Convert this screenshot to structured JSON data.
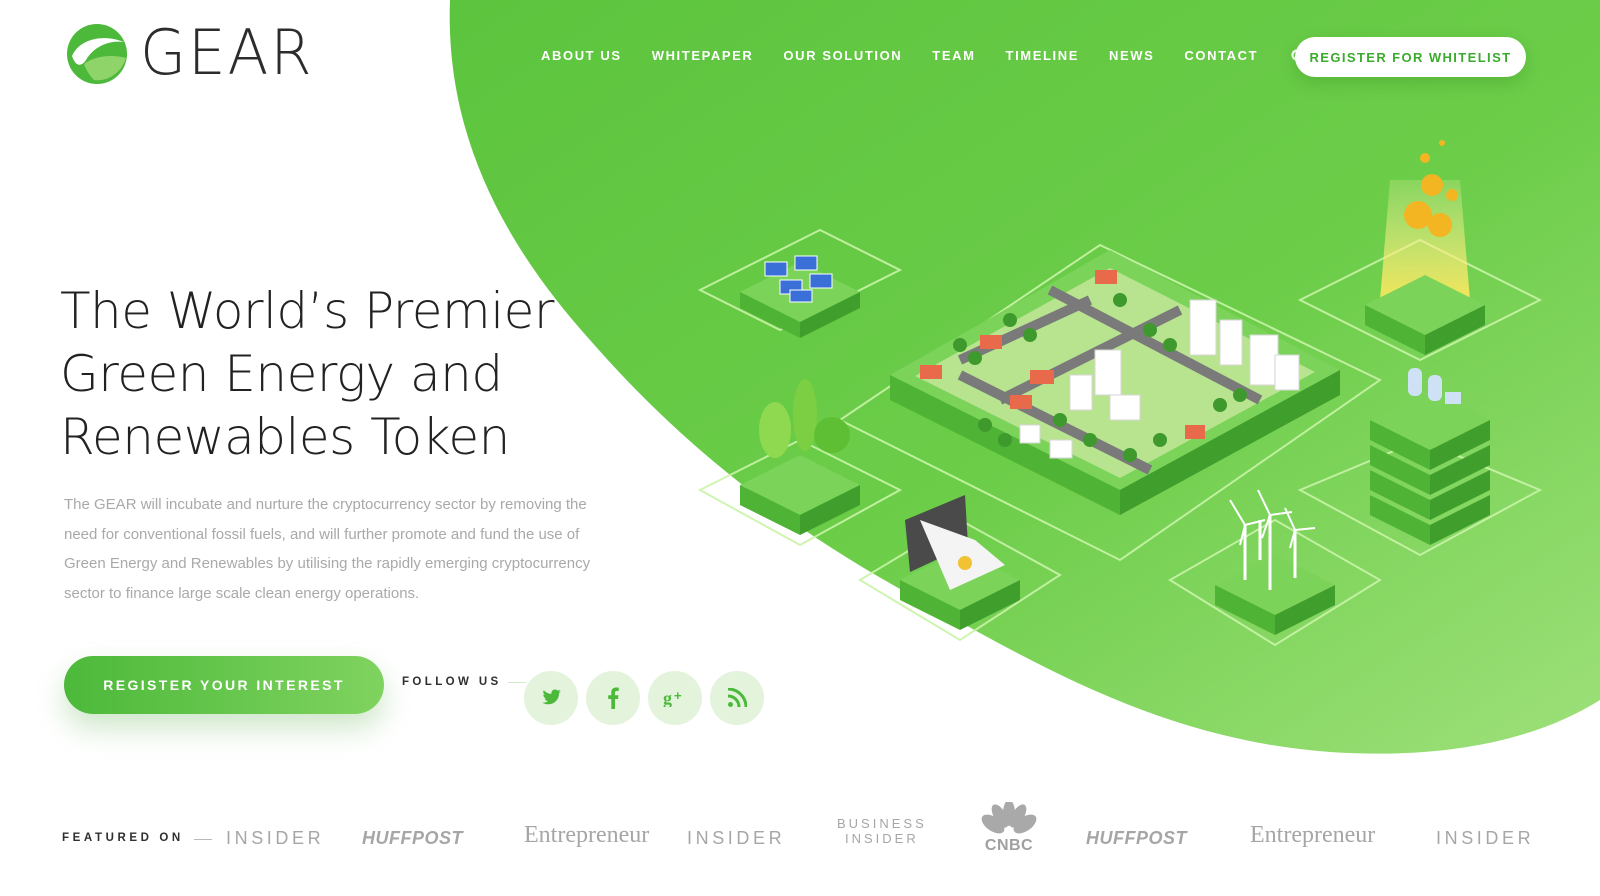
{
  "brand": {
    "name": "GEAR"
  },
  "nav": {
    "items": [
      {
        "label": "ABOUT US"
      },
      {
        "label": "WHITEPAPER"
      },
      {
        "label": "OUR SOLUTION"
      },
      {
        "label": "TEAM"
      },
      {
        "label": "TIMELINE"
      },
      {
        "label": "NEWS"
      },
      {
        "label": "CONTACT"
      }
    ],
    "search_icon": "search-icon",
    "whitelist_label": "REGISTER FOR WHITELIST"
  },
  "hero": {
    "title_lines": [
      "The World’s Premier",
      "Green Energy and",
      "Renewables Token"
    ],
    "body": "The GEAR will incubate and nurture the cryptocurrency sector by removing the need for conventional fossil fuels, and will further promote and fund the use of Green Energy and Renewables by utilising the rapidly emerging cryptocurrency sector to finance large scale clean energy operations.",
    "cta_label": "REGISTER YOUR INTEREST"
  },
  "follow": {
    "label": "FOLLOW US",
    "icons": [
      "twitter-icon",
      "facebook-icon",
      "google-plus-icon",
      "rss-icon"
    ]
  },
  "featured": {
    "label": "FEATURED ON",
    "publications": [
      {
        "name": "INSIDER"
      },
      {
        "name": "HUFFPOST"
      },
      {
        "name": "Entrepreneur"
      },
      {
        "name": "INSIDER"
      },
      {
        "name_line1": "BUSINESS",
        "name_line2": "INSIDER"
      },
      {
        "name": "CNBC"
      },
      {
        "name": "HUFFPOST"
      },
      {
        "name": "Entrepreneur"
      },
      {
        "name": "INSIDER"
      }
    ]
  },
  "colors": {
    "brand_green": "#4cb93a",
    "light_green": "#8cd968",
    "text_dark": "#222222",
    "text_muted": "#a9a9a9"
  }
}
